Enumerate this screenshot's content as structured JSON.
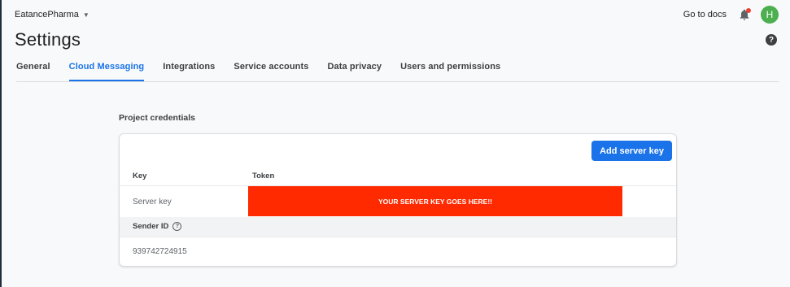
{
  "topbar": {
    "project_name": "EatancePharma",
    "docs_label": "Go to docs",
    "avatar_initial": "H"
  },
  "page": {
    "title": "Settings"
  },
  "tabs": [
    {
      "label": "General",
      "active": false
    },
    {
      "label": "Cloud Messaging",
      "active": true
    },
    {
      "label": "Integrations",
      "active": false
    },
    {
      "label": "Service accounts",
      "active": false
    },
    {
      "label": "Data privacy",
      "active": false
    },
    {
      "label": "Users and permissions",
      "active": false
    }
  ],
  "credentials": {
    "section_title": "Project credentials",
    "add_button_label": "Add server key",
    "columns": {
      "key": "Key",
      "token": "Token"
    },
    "server_key_label": "Server key",
    "server_key_token": "YOUR SERVER KEY GOES HERE!!",
    "sender_id_label": "Sender ID",
    "sender_id_value": "939742724915"
  },
  "colors": {
    "accent": "#1a73e8",
    "token_redaction": "#ff2a00",
    "avatar": "#4caf50"
  }
}
